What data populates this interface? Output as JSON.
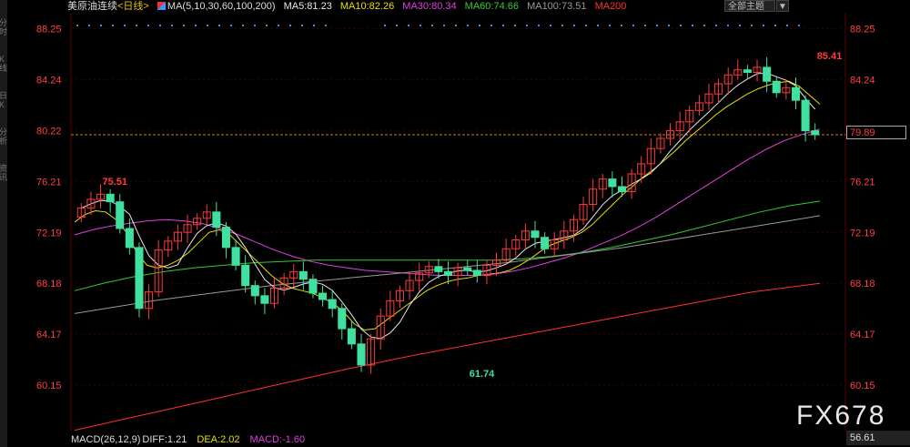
{
  "header": {
    "symbol": "美原油连续",
    "period": "<日线>",
    "ma_label": "MA(5,10,30,60,100,200)",
    "ma5": "MA5:81.23",
    "ma10": "MA10:82.26",
    "ma30": "MA30:80.34",
    "ma60": "MA60:74.66",
    "ma100": "MA100:73.51",
    "ma200": "MA200"
  },
  "buttons": {
    "all_topics": "全部主题",
    "dropdown": "▼"
  },
  "sidebar": [
    "分时",
    "K线",
    "日K",
    "分析",
    "资讯"
  ],
  "current_price_label": "79.89",
  "volume_label": "56.61",
  "watermark": "FX678",
  "macd": {
    "label": "MACD(26,12,9)",
    "diff": "DIFF:1.21",
    "dea": "DEA:2.02",
    "macd": "MACD:-1.60"
  },
  "colors": {
    "up": "#ff3b3b",
    "down": "#3fe0a0",
    "ma5": "#e8e8e8",
    "ma10": "#e6e000",
    "ma30": "#e040e0",
    "ma60": "#33cc33",
    "ma100": "#999999",
    "ma200": "#ff3030",
    "axis_text": "#ff4040",
    "grid": "#3a0000"
  },
  "chart_data": {
    "type": "candlestick",
    "ylim": [
      56.5,
      89.5
    ],
    "y_ticks": [
      88.25,
      84.24,
      80.22,
      76.21,
      72.19,
      68.18,
      64.17,
      60.15
    ],
    "reference_line": 79.89,
    "annotations": [
      {
        "label": "75.51",
        "value": 75.51,
        "index": 2
      },
      {
        "label": "61.74",
        "value": 61.74,
        "index": 40
      },
      {
        "label": "85.41",
        "value": 85.41,
        "index": 96
      }
    ],
    "closes": [
      74.1,
      74.8,
      75.2,
      74.6,
      72.5,
      71.0,
      66.2,
      67.5,
      70.8,
      71.5,
      72.2,
      72.8,
      73.3,
      73.8,
      72.6,
      71.0,
      69.6,
      68.0,
      67.2,
      66.6,
      67.8,
      68.6,
      69.1,
      68.5,
      67.4,
      66.9,
      66.2,
      64.6,
      63.4,
      61.74,
      63.8,
      65.6,
      66.8,
      67.6,
      68.4,
      69.0,
      69.5,
      69.1,
      68.8,
      69.4,
      69.2,
      68.8,
      69.6,
      70.0,
      70.9,
      71.6,
      72.3,
      71.8,
      70.9,
      71.6,
      72.3,
      73.2,
      74.4,
      75.6,
      76.4,
      75.8,
      75.4,
      76.8,
      77.6,
      78.8,
      79.6,
      80.2,
      80.9,
      81.8,
      82.4,
      83.1,
      83.9,
      84.6,
      85.0,
      84.8,
      85.2,
      84.1,
      83.2,
      83.6,
      82.6,
      80.2,
      79.89
    ],
    "opens": [
      73.4,
      74.1,
      74.8,
      75.2,
      74.6,
      72.5,
      71.0,
      66.2,
      67.5,
      70.8,
      71.5,
      72.2,
      72.8,
      73.3,
      73.8,
      72.6,
      71.0,
      69.6,
      68.0,
      67.2,
      66.6,
      67.8,
      68.6,
      69.1,
      68.5,
      67.4,
      66.9,
      66.2,
      64.6,
      63.4,
      61.74,
      63.8,
      65.6,
      66.8,
      67.6,
      68.4,
      69.0,
      69.5,
      69.1,
      68.8,
      69.4,
      69.2,
      68.8,
      69.6,
      70.0,
      70.9,
      71.6,
      72.3,
      71.8,
      70.9,
      71.6,
      72.3,
      73.2,
      74.4,
      75.6,
      76.4,
      75.8,
      75.4,
      76.8,
      77.6,
      78.8,
      79.6,
      80.2,
      80.9,
      81.8,
      82.4,
      83.1,
      83.9,
      84.6,
      85.0,
      84.8,
      85.2,
      84.1,
      83.2,
      83.6,
      82.6,
      80.2
    ],
    "ma_series": [
      {
        "name": "MA10",
        "values": [
          73.0,
          73.6,
          73.9,
          73.8,
          73.2,
          72.2,
          70.6,
          69.6,
          69.4,
          69.6,
          70.0,
          70.6,
          71.4,
          72.2,
          72.4,
          72.0,
          71.2,
          70.4,
          69.6,
          68.8,
          68.2,
          67.8,
          67.6,
          67.4,
          67.0,
          66.6,
          65.9,
          65.0,
          64.5,
          64.6,
          65.2,
          65.8,
          66.4,
          67.0,
          67.6,
          68.0,
          68.3,
          68.5,
          68.6,
          68.8,
          68.9,
          69.0,
          69.2,
          69.6,
          70.1,
          70.7,
          71.2,
          71.5,
          71.8,
          72.2,
          72.8,
          73.6,
          74.4,
          75.2,
          75.9,
          76.6,
          77.2,
          77.9,
          78.6,
          79.4,
          80.1,
          80.8,
          81.5,
          82.1,
          82.6,
          83.1,
          83.5,
          83.8,
          84.0,
          84.1,
          83.7,
          83.0,
          82.3
        ]
      },
      {
        "name": "MA30",
        "values": [
          72.0,
          72.4,
          72.7,
          72.9,
          73.1,
          73.2,
          73.1,
          72.9,
          72.5,
          72.0,
          71.4,
          70.8,
          70.3,
          69.9,
          69.6,
          69.4,
          69.2,
          69.1,
          69.0,
          68.9,
          68.8,
          68.8,
          68.8,
          68.9,
          69.1,
          69.4,
          69.8,
          70.2,
          70.7,
          71.3,
          71.9,
          72.6,
          73.4,
          74.3,
          75.2,
          76.1,
          77.0,
          77.9,
          78.7,
          79.4,
          79.9,
          80.34
        ]
      },
      {
        "name": "MA60",
        "values": [
          67.6,
          68.2,
          68.7,
          69.1,
          69.4,
          69.6,
          69.8,
          69.9,
          70.0,
          70.0,
          70.0,
          70.0,
          70.0,
          70.0,
          70.0,
          70.1,
          70.3,
          70.6,
          71.0,
          71.5,
          72.0,
          72.6,
          73.2,
          73.8,
          74.3,
          74.66
        ]
      },
      {
        "name": "MA100",
        "values": [
          65.8,
          66.3,
          66.8,
          67.2,
          67.6,
          68.0,
          68.3,
          68.6,
          68.9,
          69.2,
          69.5,
          69.8,
          70.2,
          70.6,
          71.0,
          71.5,
          72.0,
          72.5,
          73.0,
          73.51
        ]
      },
      {
        "name": "MA200",
        "values": [
          56.6,
          57.8,
          59.0,
          60.2,
          61.4,
          62.5,
          63.5,
          64.5,
          65.5,
          66.5,
          67.5,
          68.18
        ]
      }
    ]
  }
}
